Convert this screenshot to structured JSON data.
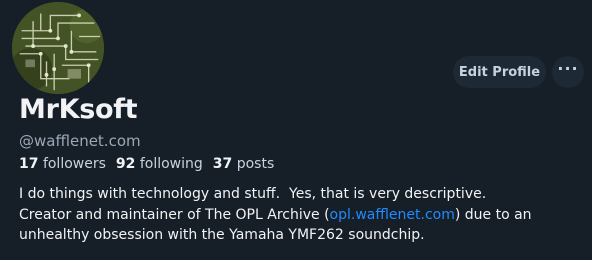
{
  "profile": {
    "display_name": "MrKsoft",
    "handle": "@wafflenet.com",
    "avatar_alt": "circuit-board-avatar"
  },
  "actions": {
    "edit_profile": "Edit Profile",
    "more": "···"
  },
  "stats": {
    "followers_count": "17",
    "followers_label": "followers",
    "following_count": "92",
    "following_label": "following",
    "posts_count": "37",
    "posts_label": "posts"
  },
  "bio": {
    "line1": "I do things with technology and stuff.  Yes, that is very descriptive.",
    "line2_prefix": "Creator and maintainer of The OPL Archive (",
    "link_text": "opl.wafflenet.com",
    "line2_suffix": ") due to an",
    "line3": "unhealthy obsession with the Yamaha YMF262 soundchip."
  },
  "colors": {
    "background": "#161e27",
    "button_bg": "#1e2936",
    "link": "#208bfe",
    "muted_text": "#9aa8b6"
  }
}
